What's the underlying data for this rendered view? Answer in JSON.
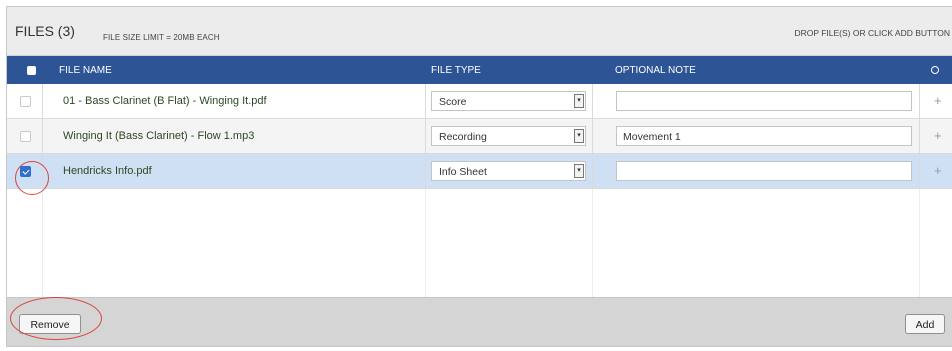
{
  "header": {
    "title": "FILES (3)",
    "size_limit": "FILE SIZE LIMIT = 20MB EACH",
    "drop_hint": "DROP FILE(S) OR CLICK ADD BUTTON"
  },
  "columns": {
    "file_name": "FILE NAME",
    "file_type": "FILE TYPE",
    "optional_note": "OPTIONAL NOTE"
  },
  "rows": [
    {
      "checked": false,
      "file_name": "01 - Bass Clarinet (B Flat) - Winging It.pdf",
      "file_type": "Score",
      "note": "",
      "action": "+"
    },
    {
      "checked": false,
      "file_name": "Winging It (Bass Clarinet) - Flow 1.mp3",
      "file_type": "Recording",
      "note": "Movement 1",
      "action": "+"
    },
    {
      "checked": true,
      "file_name": "Hendricks Info.pdf",
      "file_type": "Info Sheet",
      "note": "",
      "action": "+"
    }
  ],
  "footer": {
    "remove_label": "Remove",
    "add_label": "Add"
  },
  "colors": {
    "header_blue": "#2d5595",
    "selected_row": "#cfe0f4",
    "annotation_red": "#d8463c"
  },
  "icons": {
    "select_arrow": "dropdown-arrow-icon",
    "add_row": "plus-icon",
    "header_option": "circle-icon"
  }
}
